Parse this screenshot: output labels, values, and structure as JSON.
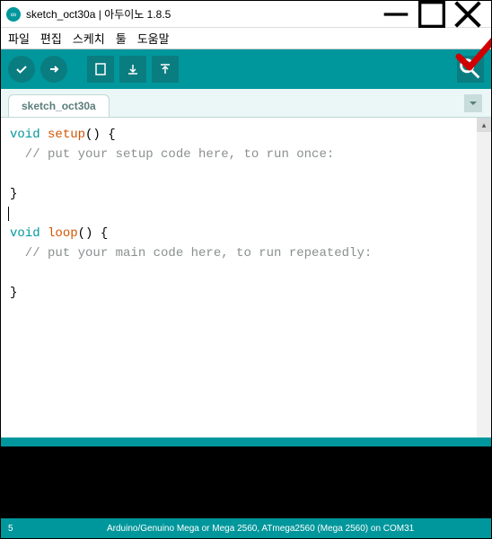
{
  "window": {
    "title": "sketch_oct30a | 아두이노 1.8.5"
  },
  "menubar": {
    "file": "파일",
    "edit": "편집",
    "sketch": "스케치",
    "tools": "툴",
    "help": "도움말"
  },
  "tab": {
    "name": "sketch_oct30a"
  },
  "code": {
    "l1_kw": "void",
    "l1_fn": " setup",
    "l1_rest": "() {",
    "l2_cm": "  // put your setup code here, to run once:",
    "l3": "",
    "l4": "}",
    "l5": "",
    "l6_kw": "void",
    "l6_fn": " loop",
    "l6_rest": "() {",
    "l7_cm": "  // put your main code here, to run repeatedly:",
    "l8": "",
    "l9": "}"
  },
  "status": {
    "line": "5",
    "board": "Arduino/Genuino Mega or Mega 2560, ATmega2560 (Mega 2560) on COM31"
  }
}
